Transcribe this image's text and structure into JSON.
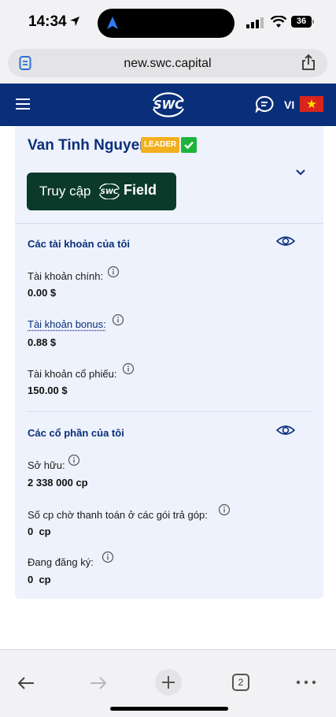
{
  "status_bar": {
    "time": "14:34",
    "battery": "36"
  },
  "browser": {
    "url": "new.swc.capital"
  },
  "header": {
    "language": "VI"
  },
  "profile": {
    "name": "Van Tinh Nguyen",
    "badge": "LEADER",
    "access_prefix": "Truy cập",
    "access_word": "Field"
  },
  "accounts": {
    "title": "Các tài khoản của tôi",
    "main_label": "Tài khoản chính:",
    "main_value": "0.00 $",
    "bonus_label": "Tài khoản bonus:",
    "bonus_value": "0.88 $",
    "stock_label": "Tài khoản cổ phiếu:",
    "stock_value": "150.00 $"
  },
  "shares": {
    "title": "Các cổ phần của tôi",
    "owned_label": "Sở hữu:",
    "owned_value": "2 338 000 cp",
    "pending_label": "Số cp chờ thanh toán ở các gói trả góp:",
    "pending_value": "0  cp",
    "registering_label": "Đang đăng ký:",
    "registering_value": "0  cp"
  },
  "toolbar": {
    "tab_count": "2"
  },
  "icons": [
    "location-arrow-icon",
    "signal-icon",
    "wifi-icon",
    "battery-icon",
    "doc-icon",
    "share-icon",
    "menu-icon",
    "swc-logo",
    "chat-icon",
    "vietnam-flag-icon",
    "verified-icon",
    "chevron-down-icon",
    "eye-icon",
    "info-icon",
    "back-icon",
    "forward-icon",
    "plus-icon",
    "more-icon"
  ],
  "colors": {
    "brand": "#0a2f7a",
    "card": "#eef2fc",
    "field_button": "#0b3a2a",
    "leader_badge": "#f2b01e",
    "verified": "#1db43a"
  }
}
